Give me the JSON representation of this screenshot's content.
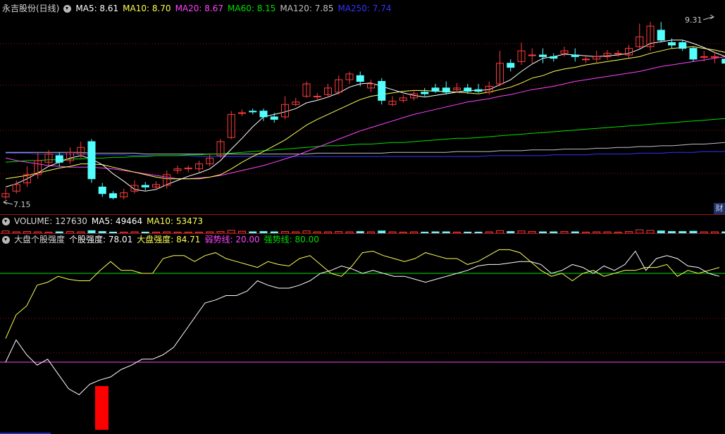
{
  "main_header": {
    "stock_name": "永吉股份(日线)",
    "ma5": "MA5: 8.61",
    "ma10": "MA10: 8.70",
    "ma20": "MA20: 8.67",
    "ma60": "MA60: 8.15",
    "ma120": "MA120: 7.85",
    "ma250": "MA250: 7.74"
  },
  "price_annotations": {
    "high": "9.31",
    "low": "7.15"
  },
  "side_button": "财",
  "volume_header": {
    "volume": "VOLUME: 127630",
    "ma5": "MA5: 49464",
    "ma10": "MA10: 53473"
  },
  "indicator_header": {
    "name": "大盘个股强度",
    "stock_strength": "个股强度: 78.01",
    "market_strength": "大盘强度: 84.71",
    "weak_line": "弱势线: 20.00",
    "strong_line": "强势线: 80.00"
  },
  "colors": {
    "up": "#ff3c3c",
    "down": "#54ffff",
    "ma5": "#ffffff",
    "ma10": "#ffff55",
    "ma20": "#ff44ff",
    "ma60": "#00e000",
    "ma120": "#c0c0c0",
    "ma250": "#3333ff",
    "grid": "#a01010"
  },
  "chart_data": {
    "type": "candlestick",
    "price_ylim": [
      7.15,
      9.31
    ],
    "candles": [
      [
        7.18,
        7.22,
        7.28,
        7.15
      ],
      [
        7.25,
        7.33,
        7.38,
        7.22
      ],
      [
        7.35,
        7.45,
        7.55,
        7.3
      ],
      [
        7.45,
        7.62,
        7.72,
        7.4
      ],
      [
        7.6,
        7.7,
        7.75,
        7.55
      ],
      [
        7.68,
        7.6,
        7.72,
        7.55
      ],
      [
        7.62,
        7.72,
        7.78,
        7.58
      ],
      [
        7.7,
        7.78,
        7.85,
        7.65
      ],
      [
        7.85,
        7.4,
        7.88,
        7.35
      ],
      [
        7.3,
        7.22,
        7.35,
        7.18
      ],
      [
        7.22,
        7.17,
        7.25,
        7.15
      ],
      [
        7.18,
        7.23,
        7.28,
        7.15
      ],
      [
        7.25,
        7.32,
        7.38,
        7.22
      ],
      [
        7.32,
        7.3,
        7.36,
        7.26
      ],
      [
        7.3,
        7.33,
        7.37,
        7.27
      ],
      [
        7.32,
        7.45,
        7.5,
        7.28
      ],
      [
        7.5,
        7.52,
        7.56,
        7.46
      ],
      [
        7.52,
        7.53,
        7.56,
        7.48
      ],
      [
        7.52,
        7.58,
        7.62,
        7.48
      ],
      [
        7.58,
        7.65,
        7.7,
        7.55
      ],
      [
        7.68,
        7.85,
        7.88,
        7.65
      ],
      [
        7.9,
        8.18,
        8.22,
        7.88
      ],
      [
        8.2,
        8.2,
        8.24,
        8.16
      ],
      [
        8.22,
        8.21,
        8.25,
        8.18
      ],
      [
        8.22,
        8.15,
        8.25,
        8.1
      ],
      [
        8.15,
        8.12,
        8.2,
        8.08
      ],
      [
        8.15,
        8.3,
        8.4,
        8.12
      ],
      [
        8.3,
        8.33,
        8.38,
        8.28
      ],
      [
        8.4,
        8.55,
        8.58,
        8.38
      ],
      [
        8.4,
        8.4,
        8.44,
        8.36
      ],
      [
        8.42,
        8.5,
        8.55,
        8.38
      ],
      [
        8.45,
        8.6,
        8.65,
        8.42
      ],
      [
        8.6,
        8.67,
        8.7,
        8.55
      ],
      [
        8.65,
        8.58,
        8.7,
        8.52
      ],
      [
        8.5,
        8.55,
        8.6,
        8.45
      ],
      [
        8.58,
        8.35,
        8.62,
        8.3
      ],
      [
        8.3,
        8.34,
        8.4,
        8.28
      ],
      [
        8.35,
        8.38,
        8.42,
        8.32
      ],
      [
        8.38,
        8.43,
        8.48,
        8.35
      ],
      [
        8.45,
        8.43,
        8.5,
        8.4
      ],
      [
        8.5,
        8.46,
        8.55,
        8.44
      ],
      [
        8.5,
        8.45,
        8.58,
        8.42
      ],
      [
        8.48,
        8.5,
        8.56,
        8.45
      ],
      [
        8.5,
        8.46,
        8.55,
        8.43
      ],
      [
        8.48,
        8.46,
        8.55,
        8.44
      ],
      [
        8.45,
        8.52,
        8.58,
        8.42
      ],
      [
        8.55,
        8.8,
        8.95,
        8.52
      ],
      [
        8.8,
        8.75,
        8.85,
        8.7
      ],
      [
        8.82,
        8.95,
        9.05,
        8.78
      ],
      [
        8.9,
        8.9,
        8.98,
        8.8
      ],
      [
        8.9,
        8.88,
        8.98,
        8.8
      ],
      [
        8.88,
        8.86,
        8.92,
        8.82
      ],
      [
        8.92,
        8.95,
        9.0,
        8.88
      ],
      [
        8.9,
        8.88,
        8.98,
        8.82
      ],
      [
        8.85,
        8.85,
        8.9,
        8.8
      ],
      [
        8.85,
        8.88,
        8.95,
        8.8
      ],
      [
        8.88,
        8.92,
        8.96,
        8.84
      ],
      [
        8.92,
        8.92,
        8.96,
        8.88
      ],
      [
        8.9,
        8.98,
        9.02,
        8.85
      ],
      [
        9.0,
        9.12,
        9.28,
        8.98
      ],
      [
        9.0,
        9.25,
        9.3,
        8.95
      ],
      [
        9.2,
        9.08,
        9.3,
        9.05
      ],
      [
        9.05,
        9.02,
        9.1,
        8.98
      ],
      [
        9.05,
        8.98,
        9.08,
        8.95
      ],
      [
        8.98,
        8.85,
        9.0,
        8.82
      ],
      [
        8.88,
        8.88,
        8.95,
        8.82
      ],
      [
        8.88,
        8.88,
        8.94,
        8.8
      ],
      [
        8.85,
        8.8,
        8.88,
        8.78
      ],
      [
        8.85,
        9.0,
        9.31,
        8.82
      ]
    ],
    "ma5": [
      7.3,
      7.34,
      7.4,
      7.47,
      7.55,
      7.6,
      7.65,
      7.68,
      7.64,
      7.57,
      7.46,
      7.37,
      7.27,
      7.25,
      7.27,
      7.33,
      7.38,
      7.43,
      7.47,
      7.52,
      7.62,
      7.76,
      7.89,
      8.03,
      8.15,
      8.18,
      8.21,
      8.25,
      8.32,
      8.35,
      8.39,
      8.44,
      8.51,
      8.55,
      8.56,
      8.52,
      8.48,
      8.44,
      8.41,
      8.39,
      8.41,
      8.43,
      8.45,
      8.47,
      8.47,
      8.48,
      8.54,
      8.6,
      8.7,
      8.79,
      8.86,
      8.88,
      8.91,
      8.9,
      8.89,
      8.88,
      8.89,
      8.9,
      8.92,
      8.97,
      9.04,
      9.06,
      9.08,
      9.08,
      9.04,
      8.99,
      8.93,
      8.88,
      8.9
    ],
    "ma10": [
      7.4,
      7.42,
      7.44,
      7.47,
      7.5,
      7.53,
      7.55,
      7.58,
      7.58,
      7.57,
      7.54,
      7.51,
      7.48,
      7.45,
      7.42,
      7.4,
      7.4,
      7.4,
      7.4,
      7.42,
      7.45,
      7.52,
      7.6,
      7.67,
      7.73,
      7.8,
      7.87,
      7.96,
      8.05,
      8.12,
      8.18,
      8.24,
      8.3,
      8.36,
      8.4,
      8.42,
      8.44,
      8.46,
      8.47,
      8.47,
      8.46,
      8.46,
      8.45,
      8.44,
      8.43,
      8.45,
      8.48,
      8.51,
      8.56,
      8.62,
      8.65,
      8.7,
      8.73,
      8.75,
      8.78,
      8.8,
      8.82,
      8.84,
      8.86,
      8.88,
      8.92,
      8.95,
      8.98,
      8.99,
      9.0,
      8.98,
      8.96,
      8.93,
      8.92
    ],
    "ma20": [
      7.65,
      7.62,
      7.6,
      7.58,
      7.56,
      7.55,
      7.54,
      7.54,
      7.54,
      7.53,
      7.52,
      7.5,
      7.48,
      7.46,
      7.44,
      7.42,
      7.4,
      7.4,
      7.41,
      7.42,
      7.44,
      7.47,
      7.5,
      7.53,
      7.56,
      7.6,
      7.64,
      7.68,
      7.73,
      7.78,
      7.83,
      7.88,
      7.93,
      7.98,
      8.02,
      8.06,
      8.1,
      8.14,
      8.18,
      8.21,
      8.24,
      8.27,
      8.3,
      8.33,
      8.35,
      8.37,
      8.4,
      8.42,
      8.45,
      8.48,
      8.5,
      8.52,
      8.55,
      8.58,
      8.6,
      8.62,
      8.64,
      8.66,
      8.68,
      8.7,
      8.73,
      8.76,
      8.78,
      8.8,
      8.82,
      8.84,
      8.86,
      8.88,
      8.89
    ],
    "ma60": [
      7.6,
      7.61,
      7.62,
      7.62,
      7.63,
      7.63,
      7.64,
      7.64,
      7.65,
      7.65,
      7.66,
      7.66,
      7.67,
      7.67,
      7.68,
      7.68,
      7.68,
      7.69,
      7.69,
      7.7,
      7.7,
      7.71,
      7.72,
      7.73,
      7.74,
      7.75,
      7.76,
      7.77,
      7.78,
      7.79,
      7.8,
      7.8,
      7.81,
      7.82,
      7.82,
      7.83,
      7.84,
      7.84,
      7.85,
      7.86,
      7.87,
      7.88,
      7.89,
      7.89,
      7.9,
      7.91,
      7.92,
      7.93,
      7.94,
      7.95,
      7.96,
      7.97,
      7.98,
      7.99,
      8.0,
      8.01,
      8.02,
      8.03,
      8.04,
      8.05,
      8.06,
      8.07,
      8.08,
      8.09,
      8.1,
      8.11,
      8.12,
      8.13,
      8.15
    ],
    "ma120": [
      7.72,
      7.72,
      7.72,
      7.72,
      7.72,
      7.72,
      7.72,
      7.72,
      7.71,
      7.71,
      7.71,
      7.71,
      7.71,
      7.7,
      7.7,
      7.7,
      7.7,
      7.7,
      7.7,
      7.7,
      7.7,
      7.7,
      7.7,
      7.7,
      7.7,
      7.7,
      7.7,
      7.7,
      7.7,
      7.71,
      7.71,
      7.71,
      7.71,
      7.71,
      7.71,
      7.71,
      7.72,
      7.72,
      7.72,
      7.72,
      7.72,
      7.72,
      7.73,
      7.73,
      7.73,
      7.73,
      7.74,
      7.74,
      7.74,
      7.75,
      7.75,
      7.75,
      7.76,
      7.76,
      7.76,
      7.77,
      7.77,
      7.78,
      7.78,
      7.79,
      7.79,
      7.8,
      7.8,
      7.81,
      7.82,
      7.82,
      7.83,
      7.84,
      7.85
    ],
    "ma250": [
      7.71,
      7.71,
      7.71,
      7.7,
      7.7,
      7.7,
      7.7,
      7.7,
      7.69,
      7.69,
      7.69,
      7.69,
      7.68,
      7.68,
      7.68,
      7.68,
      7.68,
      7.68,
      7.67,
      7.67,
      7.67,
      7.67,
      7.67,
      7.67,
      7.67,
      7.67,
      7.67,
      7.67,
      7.67,
      7.67,
      7.67,
      7.67,
      7.67,
      7.67,
      7.67,
      7.67,
      7.67,
      7.67,
      7.67,
      7.67,
      7.67,
      7.67,
      7.67,
      7.67,
      7.67,
      7.68,
      7.68,
      7.68,
      7.68,
      7.68,
      7.68,
      7.69,
      7.69,
      7.69,
      7.69,
      7.7,
      7.7,
      7.7,
      7.7,
      7.71,
      7.71,
      7.71,
      7.72,
      7.72,
      7.72,
      7.73,
      7.73,
      7.73,
      7.74
    ],
    "volume": [
      8,
      5,
      6,
      5,
      4,
      5,
      6,
      5,
      9,
      6,
      4,
      4,
      5,
      4,
      4,
      5,
      4,
      4,
      4,
      5,
      6,
      10,
      7,
      5,
      6,
      5,
      6,
      5,
      8,
      5,
      5,
      6,
      5,
      6,
      5,
      8,
      5,
      4,
      5,
      4,
      5,
      5,
      4,
      4,
      4,
      5,
      9,
      6,
      8,
      6,
      5,
      5,
      6,
      5,
      4,
      5,
      5,
      4,
      6,
      12,
      10,
      8,
      6,
      6,
      7,
      5,
      5,
      5,
      20
    ],
    "indicator_ylim": [
      0,
      100
    ],
    "stock_strength": [
      20,
      35,
      25,
      18,
      22,
      12,
      2,
      -2,
      5,
      8,
      10,
      15,
      18,
      22,
      22,
      25,
      30,
      40,
      50,
      60,
      62,
      65,
      65,
      68,
      75,
      72,
      70,
      70,
      72,
      75,
      80,
      82,
      85,
      83,
      80,
      82,
      80,
      78,
      78,
      76,
      74,
      76,
      78,
      80,
      82,
      85,
      86,
      86,
      87,
      88,
      88,
      86,
      80,
      82,
      86,
      84,
      80,
      85,
      82,
      86,
      95,
      82,
      90,
      92,
      90,
      85,
      84,
      80,
      78
    ],
    "market_strength": [
      36,
      52,
      58,
      72,
      74,
      78,
      76,
      75,
      75,
      82,
      88,
      82,
      82,
      80,
      80,
      90,
      92,
      92,
      88,
      92,
      94,
      90,
      88,
      86,
      84,
      88,
      86,
      85,
      90,
      92,
      86,
      80,
      78,
      85,
      94,
      95,
      92,
      90,
      88,
      90,
      94,
      92,
      90,
      90,
      86,
      88,
      92,
      96,
      96,
      94,
      88,
      82,
      78,
      80,
      75,
      80,
      82,
      78,
      80,
      82,
      82,
      84,
      84,
      86,
      78,
      82,
      80,
      82,
      84
    ]
  }
}
